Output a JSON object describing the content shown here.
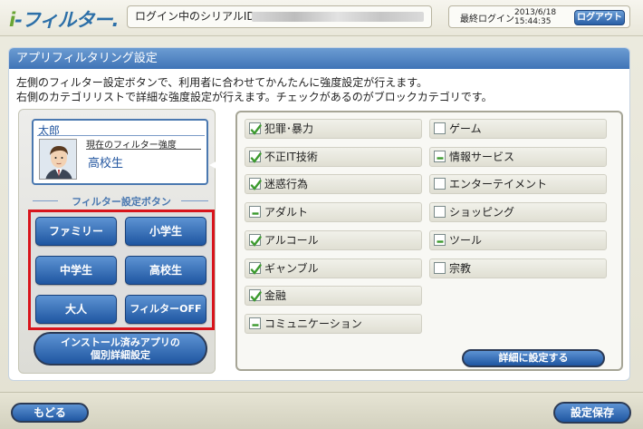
{
  "header": {
    "logo_prefix": "i",
    "logo_text": "-フィルター.",
    "serial_label": "ログイン中のシリアルID：",
    "last_login_label": "最終ログイン",
    "last_login_date": "2013/6/18",
    "last_login_time": "15:44:35",
    "logout_label": "ログアウト"
  },
  "page": {
    "title": "アプリフィルタリング設定",
    "description": [
      "左側のフィルター設定ボタンで、利用者に合わせてかんたんに強度設定が行えます。",
      "右側のカテゴリリストで詳細な強度設定が行えます。チェックがあるのがブロックカテゴリです。"
    ]
  },
  "user": {
    "name": "太郎",
    "filter_strength_label": "現在のフィルター強度",
    "filter_strength_value": "高校生"
  },
  "filter_buttons": {
    "header": "フィルター設定ボタン",
    "presets": [
      "ファミリー",
      "小学生",
      "中学生",
      "高校生",
      "大人",
      "フィルターOFF"
    ]
  },
  "install_button": [
    "インストール済みアプリの",
    "個別詳細設定"
  ],
  "categories": [
    {
      "label": "犯罪･暴力",
      "state": "checked"
    },
    {
      "label": "不正IT技術",
      "state": "checked"
    },
    {
      "label": "迷惑行為",
      "state": "checked"
    },
    {
      "label": "アダルト",
      "state": "partial"
    },
    {
      "label": "アルコール",
      "state": "checked"
    },
    {
      "label": "ギャンブル",
      "state": "checked"
    },
    {
      "label": "金融",
      "state": "checked"
    },
    {
      "label": "コミュニケーション",
      "state": "partial"
    },
    {
      "label": "ゲーム",
      "state": "unchecked"
    },
    {
      "label": "情報サービス",
      "state": "partial"
    },
    {
      "label": "エンターテイメント",
      "state": "unchecked"
    },
    {
      "label": "ショッピング",
      "state": "unchecked"
    },
    {
      "label": "ツール",
      "state": "partial"
    },
    {
      "label": "宗教",
      "state": "unchecked"
    }
  ],
  "detail_button": "詳細に設定する",
  "footer": {
    "back_label": "もどる",
    "save_label": "設定保存"
  },
  "colors": {
    "accent_blue": "#2c6fa8",
    "button_blue": "#1f56a1",
    "highlight_red": "#d8141c",
    "check_green": "#3c9a2e"
  }
}
